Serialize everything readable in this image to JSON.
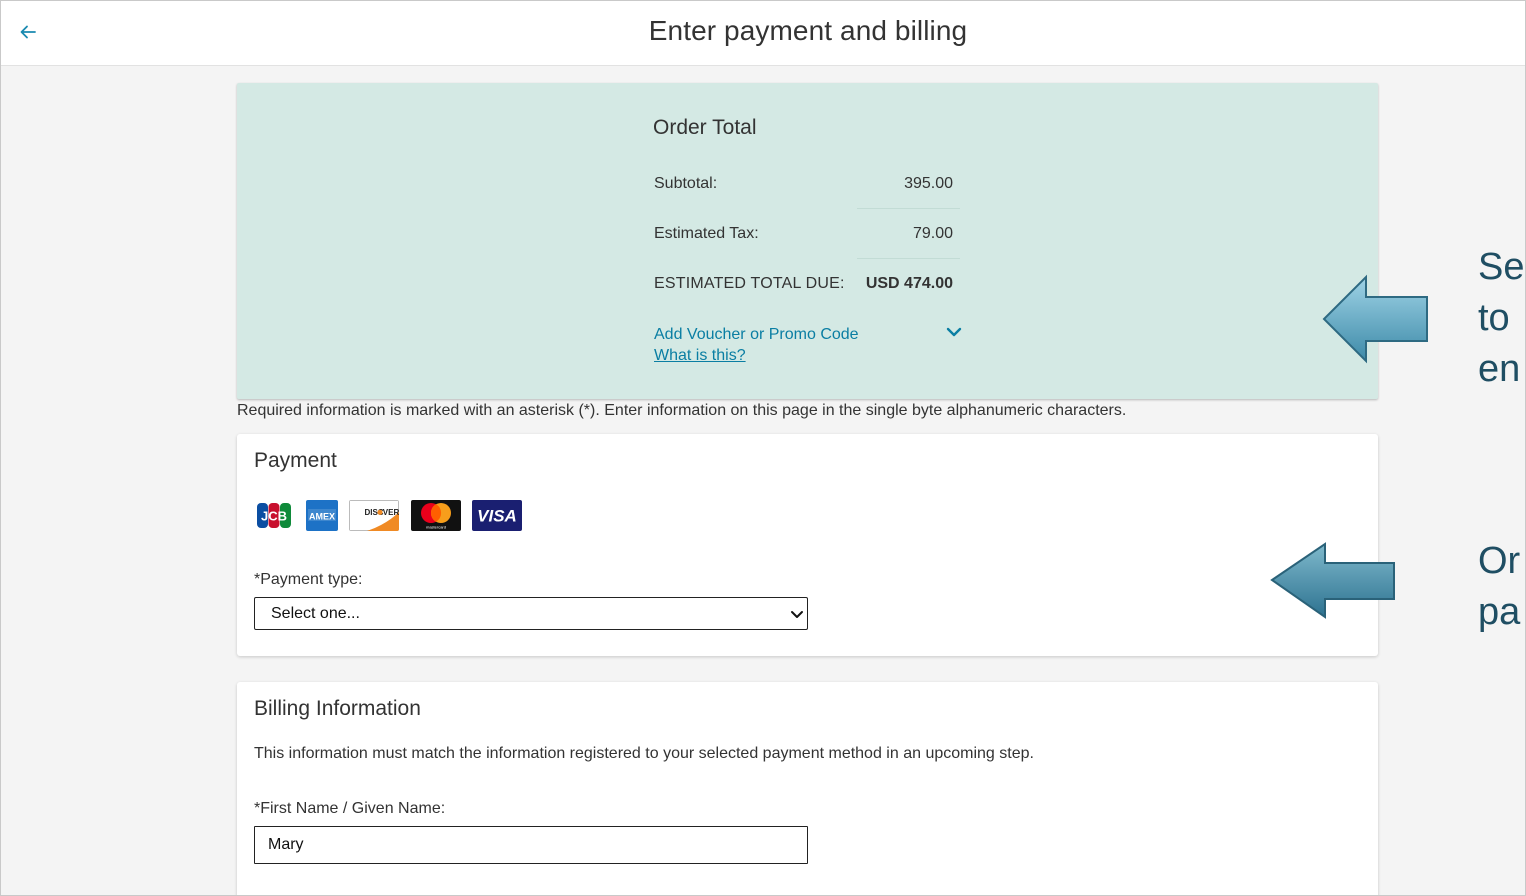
{
  "header": {
    "title": "Enter payment and billing",
    "back_icon": "arrow-left-icon"
  },
  "order_total": {
    "title": "Order Total",
    "subtotal_label": "Subtotal:",
    "subtotal_value": "395.00",
    "tax_label": "Estimated Tax:",
    "tax_value": "79.00",
    "total_label": "ESTIMATED TOTAL DUE:",
    "total_value": "USD 474.00",
    "voucher_link": "Add Voucher or Promo Code",
    "what_is_this_link": "What is this?"
  },
  "required_note": "Required information is marked with an asterisk (*). Enter information on this page in the single byte alphanumeric characters.",
  "payment": {
    "title": "Payment",
    "card_logos": [
      "JCB",
      "AMEX",
      "DISCOVER",
      "mastercard",
      "VISA"
    ],
    "payment_type_label": "*Payment type:",
    "payment_type_value": "Select one..."
  },
  "billing": {
    "title": "Billing Information",
    "note": "This information must match the information registered to your selected payment method in an upcoming step.",
    "first_name_label": "*First Name / Given Name:",
    "first_name_value": "Mary"
  },
  "annotations": {
    "upper_lines": [
      "Se",
      "to",
      "en"
    ],
    "lower_lines": [
      "Or",
      "pa"
    ]
  },
  "colors": {
    "panel_bg": "#d4e9e4",
    "link": "#0a7ea3",
    "annotation_arrow": "#4a8fa8"
  }
}
